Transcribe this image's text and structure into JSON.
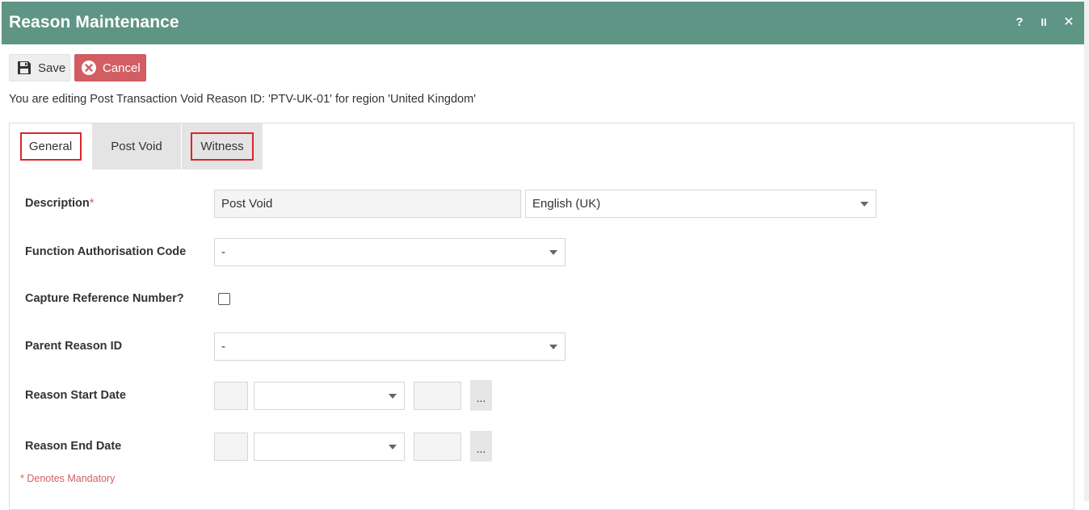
{
  "window": {
    "title": "Reason Maintenance",
    "help_icon": "?",
    "pause_icon": "II",
    "close_icon": "✕"
  },
  "toolbar": {
    "save_label": "Save",
    "cancel_label": "Cancel"
  },
  "info_text": "You are editing Post Transaction Void Reason ID: 'PTV-UK-01' for region 'United Kingdom'",
  "tabs": [
    {
      "label": "General",
      "active": true
    },
    {
      "label": "Post Void",
      "active": false
    },
    {
      "label": "Witness",
      "active": false
    }
  ],
  "form": {
    "description": {
      "label": "Description",
      "required_mark": "*",
      "value": "Post Void",
      "language": "English (UK)"
    },
    "function_authorisation_code": {
      "label": "Function Authorisation Code",
      "value": "-"
    },
    "capture_reference_number": {
      "label": "Capture Reference Number?",
      "checked": false
    },
    "parent_reason_id": {
      "label": "Parent Reason ID",
      "value": "-"
    },
    "reason_start_date": {
      "label": "Reason Start Date",
      "day": "",
      "month": "",
      "year": "",
      "picker_label": "..."
    },
    "reason_end_date": {
      "label": "Reason End Date",
      "day": "",
      "month": "",
      "year": "",
      "picker_label": "..."
    }
  },
  "mandatory_note": "* Denotes Mandatory",
  "colors": {
    "titlebar": "#5f9585",
    "cancel": "#d15e62",
    "highlight": "#d9262b",
    "mandatory": "#d15e62"
  }
}
